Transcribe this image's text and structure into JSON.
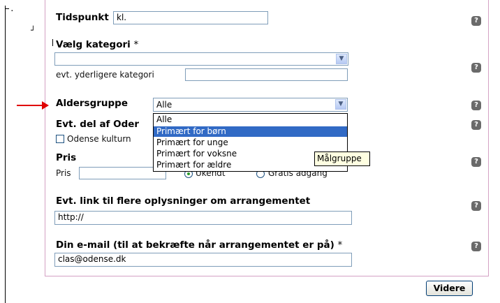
{
  "corner_marks": [
    "·",
    "┘"
  ],
  "fields": {
    "tidspunkt": {
      "label": "Tidspunkt",
      "value": "kl."
    },
    "kategori": {
      "label": "Vælg kategori",
      "required": "*",
      "value": "",
      "extra_label": "evt. yderligere kategori",
      "extra_value": ""
    },
    "aldersgruppe": {
      "label": "Aldersgruppe",
      "value": "Alle"
    },
    "del_af": {
      "label": "Evt. del af Oder",
      "checkbox_label": "Odense kulturn"
    },
    "pris": {
      "label": "Pris",
      "sub_label": "Pris",
      "value": "",
      "radio_ukendt": "Ukendt",
      "radio_gratis": "Gratis adgang"
    },
    "link": {
      "label": "Evt. link til flere oplysninger om arrangementet",
      "value": "http://"
    },
    "email": {
      "label": "Din e-mail (til at bekræfte når arrangementet er på)",
      "required": "*",
      "value": "clas@odense.dk"
    }
  },
  "dropdown": {
    "options": [
      "Alle",
      "Primært for børn",
      "Primært for unge",
      "Primært for voksne",
      "Primært for ældre"
    ],
    "selected_index": 1
  },
  "tooltip": "Målgruppe",
  "help_icon_glyph": "?",
  "submit_label": "Videre",
  "colors": {
    "border": "#d4a1c4",
    "arrow": "#e00000",
    "highlight": "#316ac5",
    "tooltip_bg": "#ffffe1"
  }
}
